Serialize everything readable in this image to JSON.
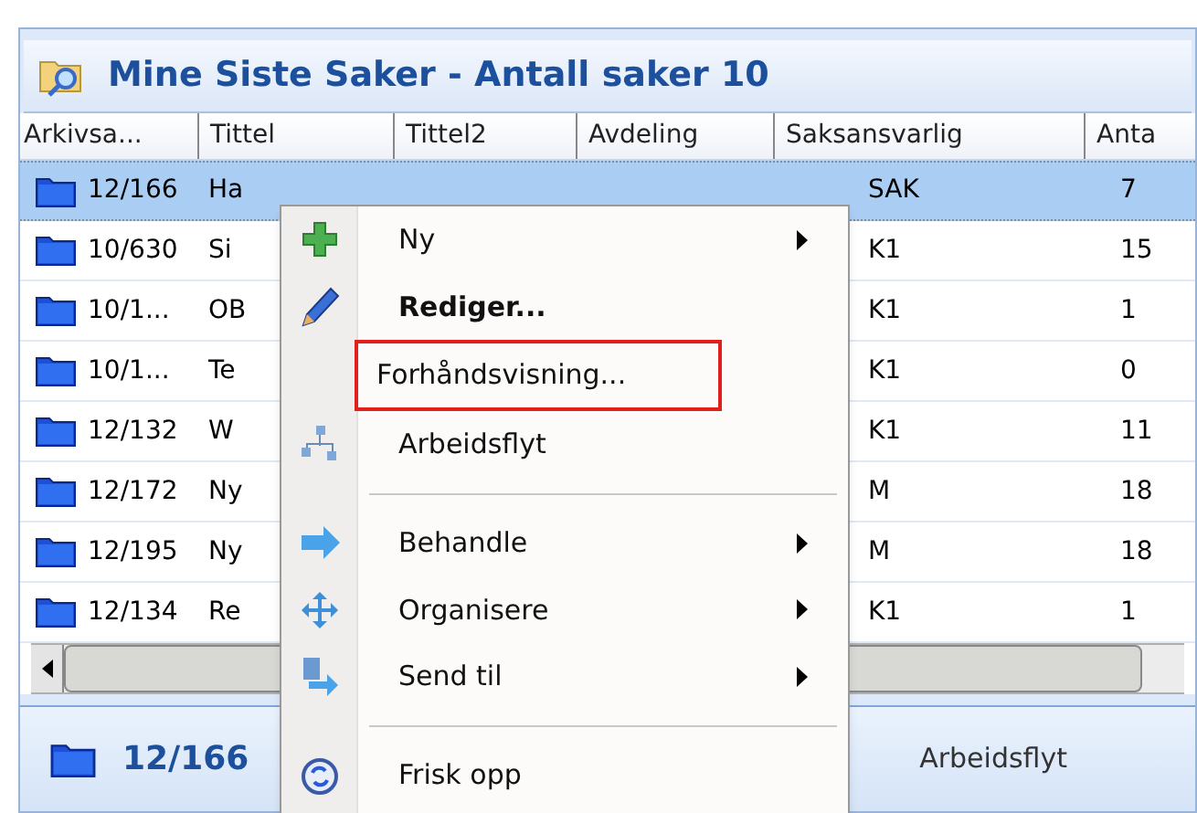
{
  "panel": {
    "title": "Mine Siste Saker - Antall saker 10"
  },
  "table": {
    "columns": [
      "Arkivsa...",
      "Tittel",
      "Tittel2",
      "Avdeling",
      "Saksansvarlig",
      "Anta"
    ],
    "rows": [
      {
        "arkivsak": "12/166",
        "tittel": "Ha",
        "saksansvarlig": "SAK",
        "antall": "7",
        "selected": true
      },
      {
        "arkivsak": "10/630",
        "tittel": "Si",
        "saksansvarlig": "K1",
        "antall": "15",
        "selected": false
      },
      {
        "arkivsak": "10/1...",
        "tittel": "OB",
        "saksansvarlig": "K1",
        "antall": "1",
        "selected": false
      },
      {
        "arkivsak": "10/1...",
        "tittel": "Te",
        "saksansvarlig": "K1",
        "antall": "0",
        "selected": false
      },
      {
        "arkivsak": "12/132",
        "tittel": "W",
        "saksansvarlig": "K1",
        "antall": "11",
        "selected": false
      },
      {
        "arkivsak": "12/172",
        "tittel": "Ny",
        "saksansvarlig": "M",
        "antall": "18",
        "selected": false
      },
      {
        "arkivsak": "12/195",
        "tittel": "Ny",
        "saksansvarlig": "M",
        "antall": "18",
        "selected": false
      },
      {
        "arkivsak": "12/134",
        "tittel": "Re",
        "saksansvarlig": "K1",
        "antall": "1",
        "selected": false
      }
    ]
  },
  "detail_bar": {
    "case_number": "12/166",
    "tab": "Arbeidsflyt"
  },
  "context_menu": {
    "items": [
      {
        "kind": "item",
        "label": "Ny",
        "bold": false,
        "submenu": true,
        "highlighted": false
      },
      {
        "kind": "item",
        "label": "Rediger...",
        "bold": true,
        "submenu": false,
        "highlighted": false
      },
      {
        "kind": "item",
        "label": "Forhåndsvisning...",
        "bold": false,
        "submenu": false,
        "highlighted": true
      },
      {
        "kind": "item",
        "label": "Arbeidsflyt",
        "bold": false,
        "submenu": false,
        "highlighted": false
      },
      {
        "kind": "separator"
      },
      {
        "kind": "item",
        "label": "Behandle",
        "bold": false,
        "submenu": true,
        "highlighted": false
      },
      {
        "kind": "item",
        "label": "Organisere",
        "bold": false,
        "submenu": true,
        "highlighted": false
      },
      {
        "kind": "item",
        "label": "Send til",
        "bold": false,
        "submenu": true,
        "highlighted": false
      },
      {
        "kind": "separator"
      },
      {
        "kind": "item",
        "label": "Frisk opp",
        "bold": false,
        "submenu": false,
        "highlighted": false
      }
    ]
  }
}
